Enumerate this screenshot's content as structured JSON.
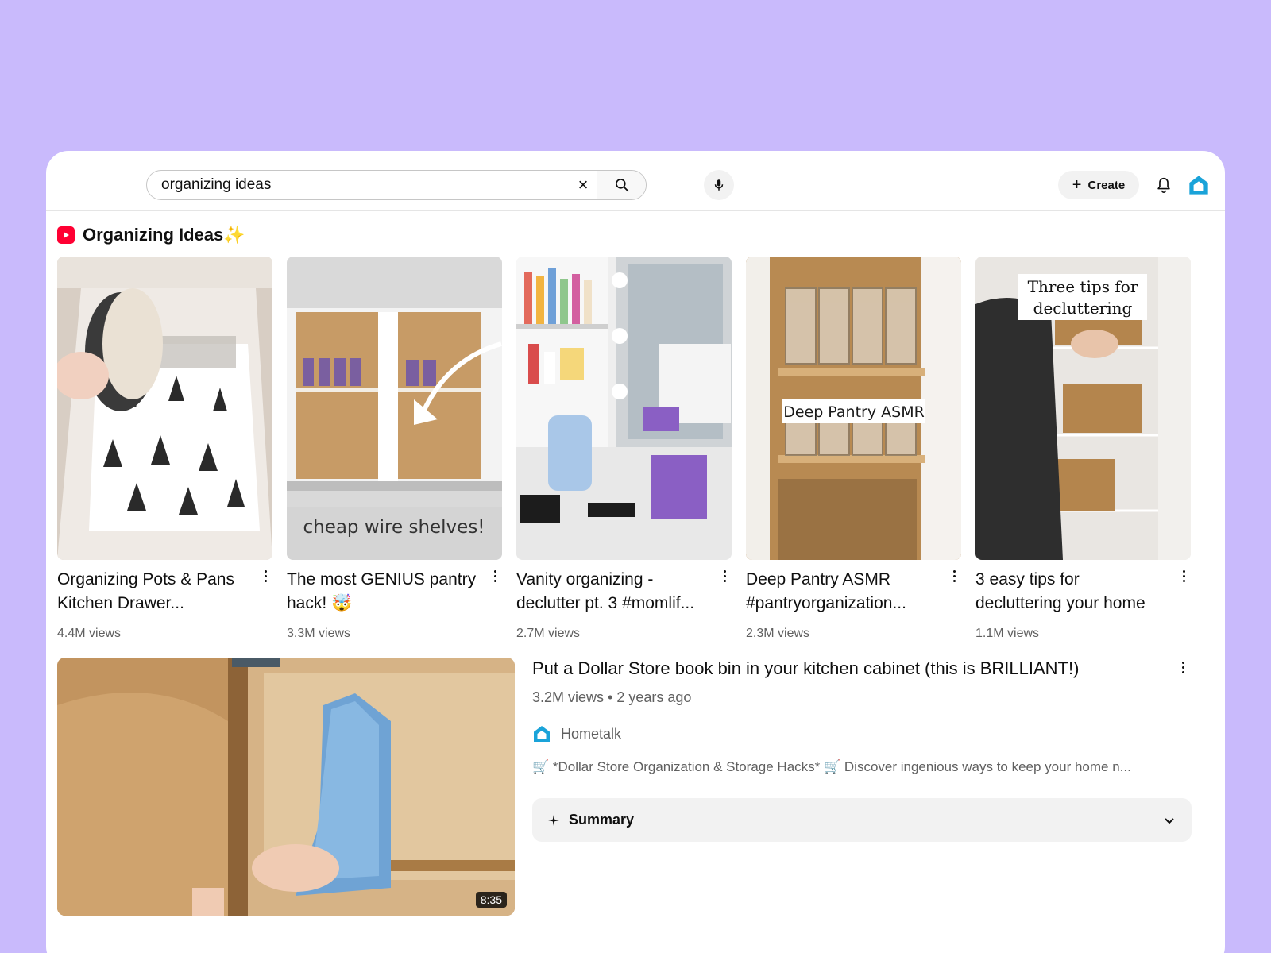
{
  "header": {
    "search": {
      "value": "organizing ideas"
    },
    "create_label": "Create",
    "icons": [
      "clear-icon",
      "search-icon",
      "mic-icon",
      "plus-icon",
      "bell-icon",
      "hometalk-logo-icon"
    ]
  },
  "shelf": {
    "title": "Organizing Ideas",
    "title_emoji": "✨",
    "shorts": [
      {
        "title": "Organizing Pots & Pans Kitchen Drawer...",
        "views": "4.4M views"
      },
      {
        "title": "The most GENIUS pantry hack! 🤯",
        "views": "3.3M views",
        "overlay": "cheap wire shelves!"
      },
      {
        "title": "Vanity organizing - declutter pt. 3 #momlif...",
        "views": "2.7M views"
      },
      {
        "title": "Deep Pantry ASMR #pantryorganization...",
        "views": "2.3M views",
        "overlay": "Deep Pantry ASMR"
      },
      {
        "title": "3 easy tips for decluttering your home",
        "views": "1.1M views",
        "overlay": "Three tips for decluttering"
      }
    ]
  },
  "video": {
    "title": "Put a Dollar Store book bin in your kitchen cabinet (this is BRILLIANT!)",
    "meta": "3.2M views • 2 years ago",
    "channel": "Hometalk",
    "description": "🛒 *Dollar Store Organization & Storage Hacks* 🛒 Discover ingenious ways to keep your home n...",
    "duration": "8:35",
    "summary_label": "Summary"
  },
  "colors": {
    "page_background": "#c9bafc",
    "brand_red": "#ff0033",
    "hometalk_blue": "#1aa3d9"
  }
}
